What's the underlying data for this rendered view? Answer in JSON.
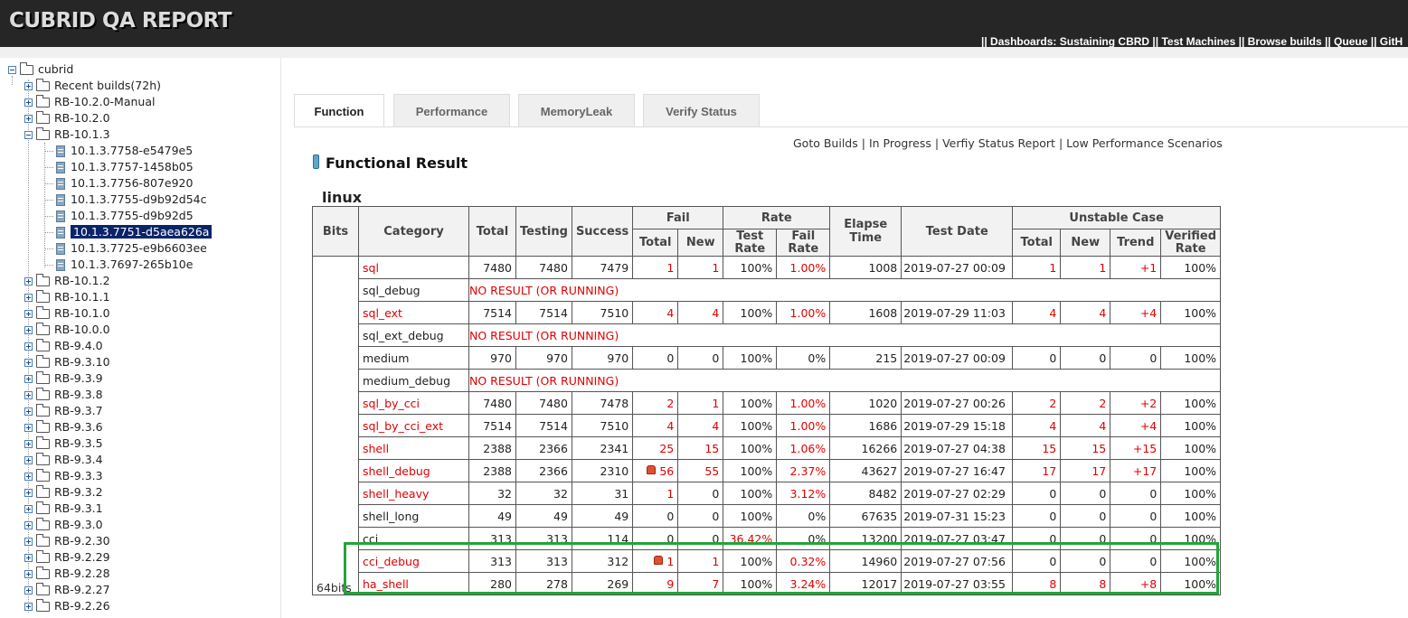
{
  "header": {
    "logo": "CUBRID QA REPORT",
    "nav": [
      "|| Dashboards: Sustaining CBRD ||",
      " Test Machines ||",
      " Browse builds ||",
      " Queue ||",
      " GitH"
    ]
  },
  "tree": {
    "root": "cubrid",
    "items_before": [
      "Recent builds(72h)",
      "RB-10.2.0-Manual",
      "RB-10.2.0"
    ],
    "expanded": "RB-10.1.3",
    "builds": [
      "10.1.3.7758-e5479e5",
      "10.1.3.7757-1458b05",
      "10.1.3.7756-807e920",
      "10.1.3.7755-d9b92d54c",
      "10.1.3.7755-d9b92d5",
      "10.1.3.7751-d5aea626a",
      "10.1.3.7725-e9b6603ee",
      "10.1.3.7697-265b10e"
    ],
    "selected_build": "10.1.3.7751-d5aea626a",
    "items_after": [
      "RB-10.1.2",
      "RB-10.1.1",
      "RB-10.1.0",
      "RB-10.0.0",
      "RB-9.4.0",
      "RB-9.3.10",
      "RB-9.3.9",
      "RB-9.3.8",
      "RB-9.3.7",
      "RB-9.3.6",
      "RB-9.3.5",
      "RB-9.3.4",
      "RB-9.3.3",
      "RB-9.3.2",
      "RB-9.3.1",
      "RB-9.3.0",
      "RB-9.2.30",
      "RB-9.2.29",
      "RB-9.2.28",
      "RB-9.2.27",
      "RB-9.2.26"
    ]
  },
  "tabs": [
    "Function",
    "Performance",
    "MemoryLeak",
    "Verify Status"
  ],
  "active_tab": "Function",
  "links": [
    "Goto Builds",
    "In Progress",
    "Verfiy Status Report",
    "Low Performance Scenarios"
  ],
  "link_sep": "|",
  "section_title": "Functional Result",
  "os_label": "linux",
  "table": {
    "headers": {
      "bits": "Bits",
      "category": "Category",
      "total": "Total",
      "testing": "Testing",
      "success": "Success",
      "fail": "Fail",
      "rate": "Rate",
      "elapse": "Elapse Time",
      "date": "Test Date",
      "unstable": "Unstable Case",
      "fail_total": "Total",
      "fail_new": "New",
      "test_rate": "Test Rate",
      "fail_rate": "Fail Rate",
      "u_total": "Total",
      "u_new": "New",
      "u_trend": "Trend",
      "u_verified": "Verified Rate"
    },
    "bits_value": "64bits",
    "no_result_text": "NO RESULT (OR RUNNING)",
    "rows": [
      {
        "cat": "sql",
        "red": true,
        "total": "7480",
        "testing": "7480",
        "success": "7479",
        "fail_total": "1",
        "fail_new": "1",
        "test_rate": "100%",
        "fail_rate": "1.00%",
        "elapse": "1008",
        "date": "2019-07-27 00:09",
        "u_total": "1",
        "u_new": "1",
        "u_trend": "+1",
        "verified": "100%"
      },
      {
        "cat": "sql_debug",
        "red": false,
        "noresult": true
      },
      {
        "cat": "sql_ext",
        "red": true,
        "total": "7514",
        "testing": "7514",
        "success": "7510",
        "fail_total": "4",
        "fail_new": "4",
        "test_rate": "100%",
        "fail_rate": "1.00%",
        "elapse": "1608",
        "date": "2019-07-29 11:03",
        "u_total": "4",
        "u_new": "4",
        "u_trend": "+4",
        "verified": "100%"
      },
      {
        "cat": "sql_ext_debug",
        "red": false,
        "noresult": true
      },
      {
        "cat": "medium",
        "red": false,
        "total": "970",
        "testing": "970",
        "success": "970",
        "fail_total": "0",
        "fail_new": "0",
        "test_rate": "100%",
        "fail_rate": "0%",
        "elapse": "215",
        "date": "2019-07-27 00:09",
        "u_total": "0",
        "u_new": "0",
        "u_trend": "0",
        "verified": "100%"
      },
      {
        "cat": "medium_debug",
        "red": false,
        "noresult": true
      },
      {
        "cat": "sql_by_cci",
        "red": true,
        "total": "7480",
        "testing": "7480",
        "success": "7478",
        "fail_total": "2",
        "fail_new": "1",
        "test_rate": "100%",
        "fail_rate": "1.00%",
        "elapse": "1020",
        "date": "2019-07-27 00:26",
        "u_total": "2",
        "u_new": "2",
        "u_trend": "+2",
        "verified": "100%"
      },
      {
        "cat": "sql_by_cci_ext",
        "red": true,
        "total": "7514",
        "testing": "7514",
        "success": "7510",
        "fail_total": "4",
        "fail_new": "4",
        "test_rate": "100%",
        "fail_rate": "1.00%",
        "elapse": "1686",
        "date": "2019-07-29 15:18",
        "u_total": "4",
        "u_new": "4",
        "u_trend": "+4",
        "verified": "100%"
      },
      {
        "cat": "shell",
        "red": true,
        "total": "2388",
        "testing": "2366",
        "success": "2341",
        "fail_total": "25",
        "fail_new": "15",
        "test_rate": "100%",
        "fail_rate": "1.06%",
        "elapse": "16266",
        "date": "2019-07-27 04:38",
        "u_total": "15",
        "u_new": "15",
        "u_trend": "+15",
        "verified": "100%"
      },
      {
        "cat": "shell_debug",
        "red": true,
        "alert": true,
        "total": "2388",
        "testing": "2366",
        "success": "2310",
        "fail_total": "56",
        "fail_new": "55",
        "test_rate": "100%",
        "fail_rate": "2.37%",
        "elapse": "43627",
        "date": "2019-07-27 16:47",
        "u_total": "17",
        "u_new": "17",
        "u_trend": "+17",
        "verified": "100%"
      },
      {
        "cat": "shell_heavy",
        "red": true,
        "total": "32",
        "testing": "32",
        "success": "31",
        "fail_total": "1",
        "fail_new": "0",
        "test_rate": "100%",
        "fail_rate": "3.12%",
        "elapse": "8482",
        "date": "2019-07-27 02:29",
        "u_total": "0",
        "u_new": "0",
        "u_trend": "0",
        "verified": "100%"
      },
      {
        "cat": "shell_long",
        "red": false,
        "total": "49",
        "testing": "49",
        "success": "49",
        "fail_total": "0",
        "fail_new": "0",
        "test_rate": "100%",
        "fail_rate": "0%",
        "elapse": "67635",
        "date": "2019-07-31 15:23",
        "u_total": "0",
        "u_new": "0",
        "u_trend": "0",
        "verified": "100%"
      },
      {
        "cat": "cci",
        "red": false,
        "total": "313",
        "testing": "313",
        "success": "114",
        "fail_total": "0",
        "fail_new": "0",
        "test_rate": "36.42%",
        "test_rate_red": true,
        "fail_rate": "0%",
        "elapse": "13200",
        "date": "2019-07-27 03:47",
        "u_total": "0",
        "u_new": "0",
        "u_trend": "0",
        "verified": "100%"
      },
      {
        "cat": "cci_debug",
        "red": true,
        "alert": true,
        "total": "313",
        "testing": "313",
        "success": "312",
        "fail_total": "1",
        "fail_new": "1",
        "test_rate": "100%",
        "fail_rate": "0.32%",
        "elapse": "14960",
        "date": "2019-07-27 07:56",
        "u_total": "0",
        "u_new": "0",
        "u_trend": "0",
        "verified": "100%"
      },
      {
        "cat": "ha_shell",
        "red": true,
        "total": "280",
        "testing": "278",
        "success": "269",
        "fail_total": "9",
        "fail_new": "7",
        "test_rate": "100%",
        "fail_rate": "3.24%",
        "elapse": "12017",
        "date": "2019-07-27 03:55",
        "u_total": "8",
        "u_new": "8",
        "u_trend": "+8",
        "verified": "100%"
      }
    ]
  },
  "colors": {
    "header_bg": "#262626",
    "fail_red": "#e00000",
    "highlight_box": "#22a43a",
    "selection": "#0a246a"
  }
}
